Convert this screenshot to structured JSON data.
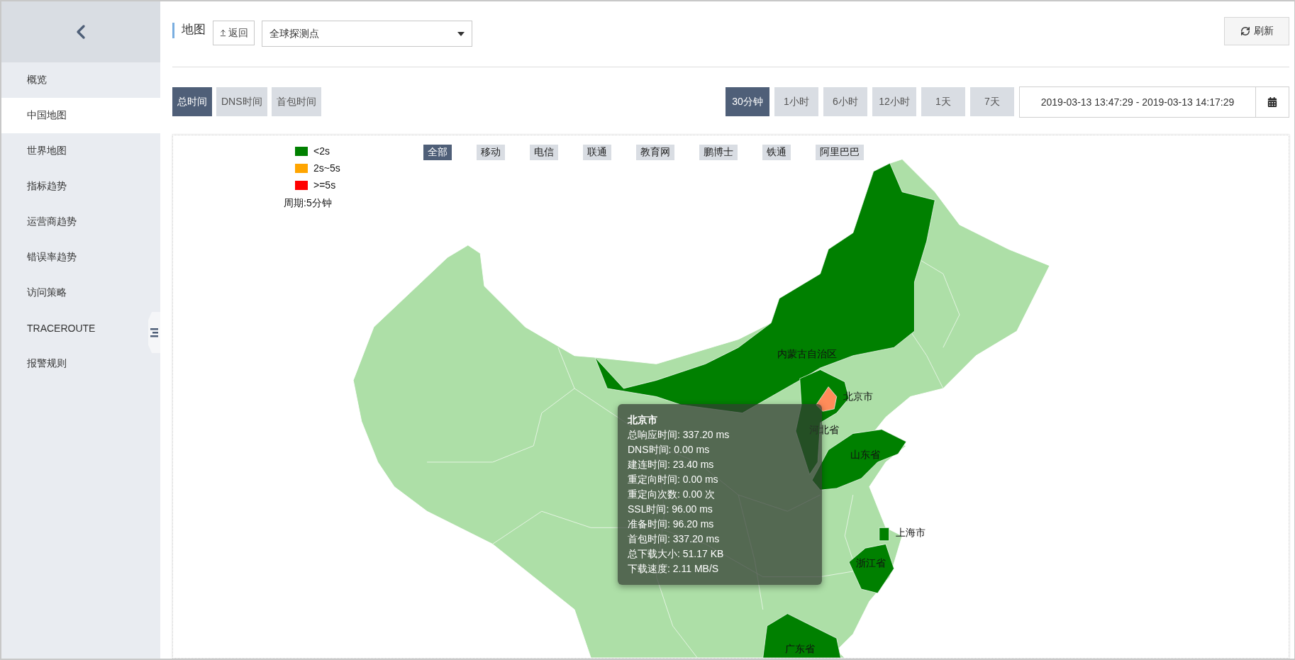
{
  "sidebar": {
    "items": [
      {
        "label": "概览",
        "selected": false
      },
      {
        "label": "中国地图",
        "selected": true
      },
      {
        "label": "世界地图",
        "selected": false
      },
      {
        "label": "指标趋势",
        "selected": false
      },
      {
        "label": "运营商趋势",
        "selected": false
      },
      {
        "label": "错误率趋势",
        "selected": false
      },
      {
        "label": "访问策略",
        "selected": false
      },
      {
        "label": "TRACEROUTE",
        "selected": false
      },
      {
        "label": "报警规则",
        "selected": false
      }
    ]
  },
  "header": {
    "title": "地图",
    "back_button": "返回",
    "probe_select": {
      "value": "全球探测点"
    },
    "refresh_button": "刷新"
  },
  "metric_tabs": [
    {
      "label": "总时间",
      "selected": true
    },
    {
      "label": "DNS时间",
      "selected": false
    },
    {
      "label": "首包时间",
      "selected": false
    }
  ],
  "range_tabs": [
    {
      "label": "30分钟",
      "selected": true
    },
    {
      "label": "1小时",
      "selected": false
    },
    {
      "label": "6小时",
      "selected": false
    },
    {
      "label": "12小时",
      "selected": false
    },
    {
      "label": "1天",
      "selected": false
    },
    {
      "label": "7天",
      "selected": false
    }
  ],
  "date_range": {
    "value": "2019-03-13 13:47:29 - 2019-03-13 14:17:29"
  },
  "map": {
    "legend": [
      {
        "label": "<2s",
        "color": "#008000"
      },
      {
        "label": "2s~5s",
        "color": "#ffa500"
      },
      {
        "label": ">=5s",
        "color": "#ff0000"
      }
    ],
    "period": "周期:5分钟",
    "isp_tabs": [
      {
        "label": "全部",
        "selected": true
      },
      {
        "label": "移动",
        "selected": false
      },
      {
        "label": "电信",
        "selected": false
      },
      {
        "label": "联通",
        "selected": false
      },
      {
        "label": "教育网",
        "selected": false
      },
      {
        "label": "鹏博士",
        "selected": false
      },
      {
        "label": "铁通",
        "selected": false
      },
      {
        "label": "阿里巴巴",
        "selected": false
      }
    ],
    "provinces": [
      {
        "name": "内蒙古自治区",
        "color": "#008000"
      },
      {
        "name": "河北省",
        "color": "#008000"
      },
      {
        "name": "北京市",
        "color": "#ff8c5a"
      },
      {
        "name": "山东省",
        "color": "#008000"
      },
      {
        "name": "上海市",
        "color": "#008000"
      },
      {
        "name": "浙江省",
        "color": "#008000"
      },
      {
        "name": "广东省",
        "color": "#008000"
      }
    ],
    "tooltip": {
      "title": "北京市",
      "lines": [
        "总响应时间: 337.20 ms",
        "DNS时间: 0.00 ms",
        "建连时间: 23.40 ms",
        "重定向时间: 0.00 ms",
        "重定向次数: 0.00 次",
        "SSL时间: 96.00 ms",
        "准备时间: 96.20 ms",
        "首包时间: 337.20 ms",
        "总下载大小: 51.17 KB",
        "下载速度: 2.11 MB/S"
      ]
    }
  }
}
